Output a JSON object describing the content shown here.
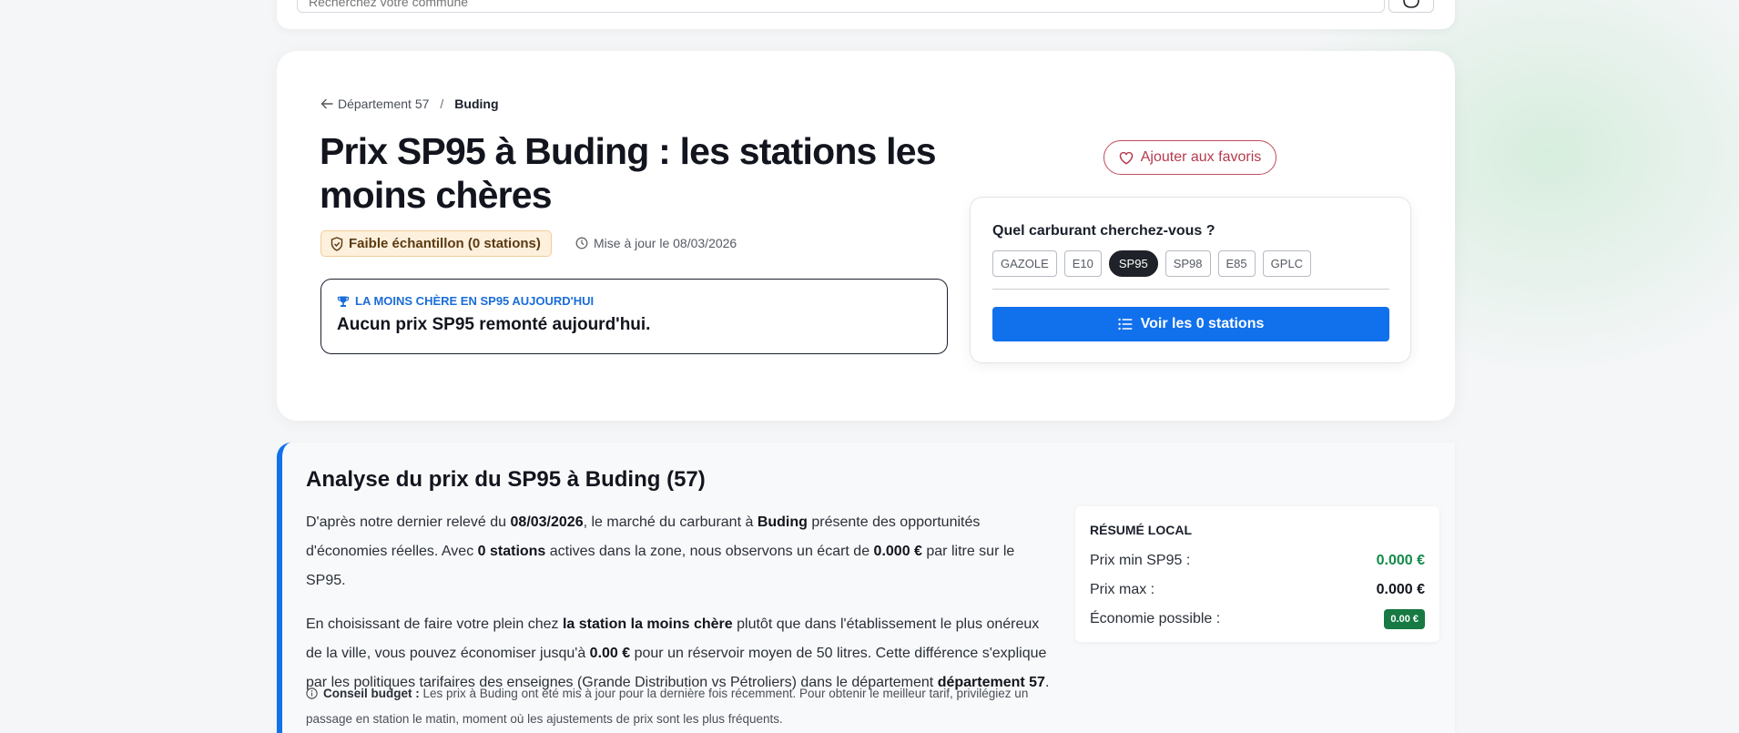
{
  "search": {
    "placeholder": "Recherchez votre commune"
  },
  "breadcrumb": {
    "parent": "Département 57",
    "separator": "/",
    "current": "Buding"
  },
  "hero": {
    "title": "Prix SP95 à Buding : les stations les moins chères",
    "sample_badge": "Faible échantillon (0 stations)",
    "updated": "Mise à jour le 08/03/2026",
    "cheapest_kicker": "LA MOINS CHÈRE EN SP95 AUJOURD'HUI",
    "cheapest_text": "Aucun prix SP95 remonté aujourd'hui.",
    "favorite_label": "Ajouter aux favoris"
  },
  "fuel_selector": {
    "question": "Quel carburant cherchez-vous ?",
    "options": [
      "GAZOLE",
      "E10",
      "SP95",
      "SP98",
      "E85",
      "GPLC"
    ],
    "selected": "SP95",
    "button_label": "Voir les 0 stations"
  },
  "analysis": {
    "title": "Analyse du prix du SP95 à Buding (57)",
    "p1": {
      "a": "D'après notre dernier relevé du ",
      "date": "08/03/2026",
      "b": ", le marché du carburant à ",
      "city": "Buding",
      "c": " présente des opportunités d'économies réelles. Avec ",
      "stations": "0 stations",
      "d": " actives dans la zone, nous observons un écart de ",
      "gap": "0.000 €",
      "e": " par litre sur le SP95."
    },
    "p2": {
      "a": "En choisissant de faire votre plein chez ",
      "cheapest": "la station la moins chère",
      "b": " plutôt que dans l'établissement le plus onéreux de la ville, vous pouvez économiser jusqu'à ",
      "saving": "0.00 €",
      "c": " pour un réservoir moyen de 50 litres. Cette différence s'explique par les politiques tarifaires des enseignes (Grande Distribution vs Pétroliers) dans le département ",
      "dept": "département 57",
      "d": "."
    },
    "tip": {
      "label": "Conseil budget :",
      "text": " Les prix à Buding ont été mis à jour pour la dernière fois récemment. Pour obtenir le meilleur tarif, privilégiez un passage en station le matin, moment où les ajustements de prix sont les plus fréquents."
    }
  },
  "summary": {
    "title": "RÉSUMÉ LOCAL",
    "min_label": "Prix min SP95 :",
    "min_value": "0.000 €",
    "max_label": "Prix max :",
    "max_value": "0.000 €",
    "eco_label": "Économie possible :",
    "eco_value": "0.00 €"
  },
  "colors": {
    "accent_blue": "#1170ec",
    "favorite_red": "#c04b5c",
    "green": "#138a4a",
    "warning_bg": "#fdf0dc"
  }
}
